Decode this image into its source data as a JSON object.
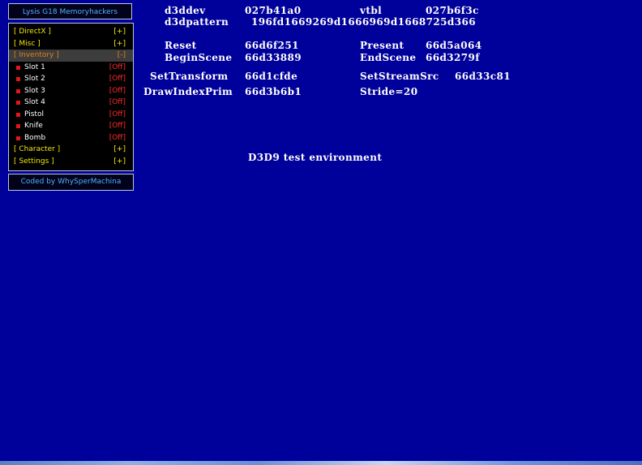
{
  "menu": {
    "title": "Lysis G18 Memoryhackers",
    "items": [
      {
        "label": "[ DirectX ]",
        "value": "[+]",
        "kind": "category",
        "active": false
      },
      {
        "label": "[ Misc ]",
        "value": "[+]",
        "kind": "category",
        "active": false
      },
      {
        "label": "[ Inventory ]",
        "value": "[-]",
        "kind": "category",
        "active": true
      },
      {
        "label": "Slot 1",
        "value": "[Off]",
        "kind": "item"
      },
      {
        "label": "Slot 2",
        "value": "[Off]",
        "kind": "item"
      },
      {
        "label": "Slot 3",
        "value": "[Off]",
        "kind": "item"
      },
      {
        "label": "Slot 4",
        "value": "[Off]",
        "kind": "item"
      },
      {
        "label": "Pistol",
        "value": "[Off]",
        "kind": "item"
      },
      {
        "label": "Knife",
        "value": "[Off]",
        "kind": "item"
      },
      {
        "label": "Bomb",
        "value": "[Off]",
        "kind": "item"
      },
      {
        "label": "[ Character ]",
        "value": "[+]",
        "kind": "category",
        "active": false
      },
      {
        "label": "[ Settings ]",
        "value": "[+]",
        "kind": "category",
        "active": false
      }
    ],
    "credit": "Coded by WhySperMachina"
  },
  "debug": {
    "d3ddev_label": "d3ddev",
    "d3ddev_value": "027b41a0",
    "vtbl_label": "vtbl",
    "vtbl_value": "027b6f3c",
    "pattern_label": "d3dpattern",
    "pattern_value": "196fd1669269d1666969d1668725d366",
    "reset_label": "Reset",
    "reset_value": "66d6f251",
    "present_label": "Present",
    "present_value": "66d5a064",
    "beginscene_label": "BeginScene",
    "beginscene_value": "66d33889",
    "endscene_label": "EndScene",
    "endscene_value": "66d3279f",
    "settransform_label": "SetTransform",
    "settransform_value": "66d1cfde",
    "setstreamsrc_label": "SetStreamSrc",
    "setstreamsrc_value": "66d33c81",
    "drawindexprim_label": "DrawIndexPrim",
    "drawindexprim_value": "66d3b6b1",
    "stride_text": "Stride=20"
  },
  "environment_label": "D3D9 test environment",
  "colors": {
    "background": "#00009a",
    "category": "#f1e70b",
    "active_category": "#e77d18",
    "off": "#ff2a2a",
    "title": "#4fb3ff"
  }
}
